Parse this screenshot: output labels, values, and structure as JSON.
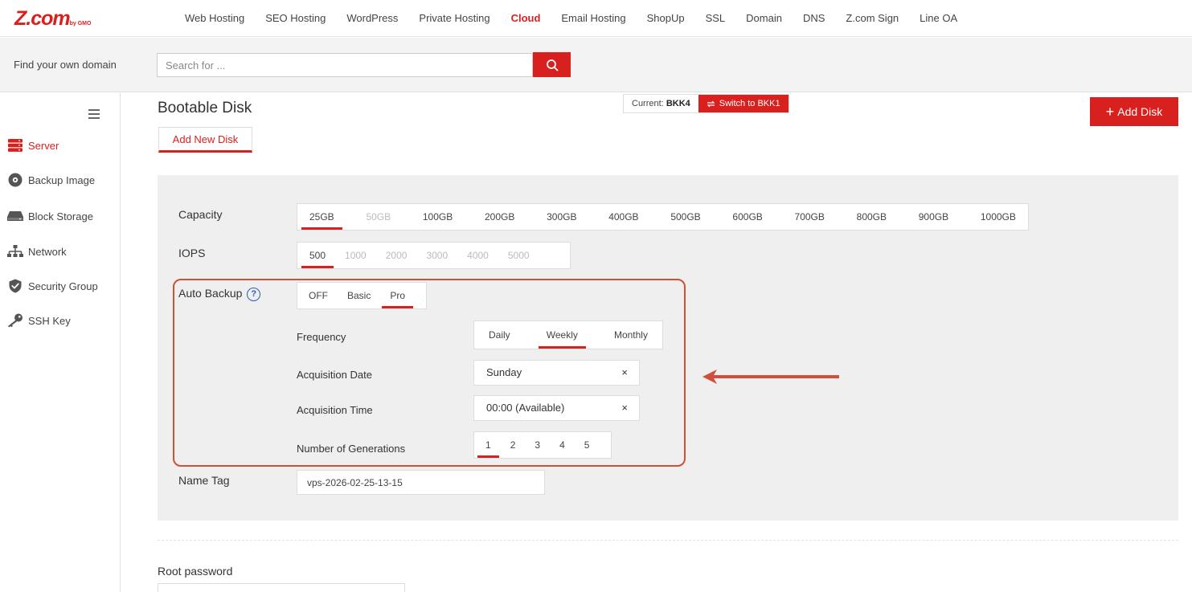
{
  "brand": {
    "logo_main": "Z.com",
    "logo_sub": "by GMO"
  },
  "nav": {
    "items": [
      {
        "label": "Web Hosting",
        "active": false
      },
      {
        "label": "SEO Hosting",
        "active": false
      },
      {
        "label": "WordPress",
        "active": false
      },
      {
        "label": "Private Hosting",
        "active": false
      },
      {
        "label": "Cloud",
        "active": true
      },
      {
        "label": "Email Hosting",
        "active": false
      },
      {
        "label": "ShopUp",
        "active": false
      },
      {
        "label": "SSL",
        "active": false
      },
      {
        "label": "Domain",
        "active": false
      },
      {
        "label": "DNS",
        "active": false
      },
      {
        "label": "Z.com Sign",
        "active": false
      },
      {
        "label": "Line OA",
        "active": false
      }
    ]
  },
  "search": {
    "label": "Find your own domain",
    "placeholder": "Search for ..."
  },
  "sidebar": {
    "items": [
      {
        "label": "Server",
        "icon": "server-icon",
        "active": true
      },
      {
        "label": "Backup Image",
        "icon": "disc-icon",
        "active": false
      },
      {
        "label": "Block Storage",
        "icon": "drive-icon",
        "active": false
      },
      {
        "label": "Network",
        "icon": "network-icon",
        "active": false
      },
      {
        "label": "Security Group",
        "icon": "shield-icon",
        "active": false
      },
      {
        "label": "SSH Key",
        "icon": "key-icon",
        "active": false
      }
    ]
  },
  "main": {
    "title": "Bootable Disk",
    "subtab": "Add New Disk",
    "region": {
      "current_label": "Current:",
      "current_value": "BKK4",
      "switch_label": "Switch to BKK1"
    },
    "add_disk_label": "Add Disk"
  },
  "form": {
    "capacity": {
      "label": "Capacity",
      "options": [
        {
          "label": "25GB",
          "selected": true,
          "disabled": false
        },
        {
          "label": "50GB",
          "selected": false,
          "disabled": true
        },
        {
          "label": "100GB",
          "selected": false,
          "disabled": false
        },
        {
          "label": "200GB",
          "selected": false,
          "disabled": false
        },
        {
          "label": "300GB",
          "selected": false,
          "disabled": false
        },
        {
          "label": "400GB",
          "selected": false,
          "disabled": false
        },
        {
          "label": "500GB",
          "selected": false,
          "disabled": false
        },
        {
          "label": "600GB",
          "selected": false,
          "disabled": false
        },
        {
          "label": "700GB",
          "selected": false,
          "disabled": false
        },
        {
          "label": "800GB",
          "selected": false,
          "disabled": false
        },
        {
          "label": "900GB",
          "selected": false,
          "disabled": false
        },
        {
          "label": "1000GB",
          "selected": false,
          "disabled": false
        }
      ]
    },
    "iops": {
      "label": "IOPS",
      "options": [
        {
          "label": "500",
          "selected": true,
          "disabled": false
        },
        {
          "label": "1000",
          "selected": false,
          "disabled": true
        },
        {
          "label": "2000",
          "selected": false,
          "disabled": true
        },
        {
          "label": "3000",
          "selected": false,
          "disabled": true
        },
        {
          "label": "4000",
          "selected": false,
          "disabled": true
        },
        {
          "label": "5000",
          "selected": false,
          "disabled": true
        }
      ]
    },
    "auto_backup": {
      "label": "Auto Backup",
      "help": "?",
      "options": [
        {
          "label": "OFF",
          "selected": false
        },
        {
          "label": "Basic",
          "selected": false
        },
        {
          "label": "Pro",
          "selected": true
        }
      ],
      "frequency": {
        "label": "Frequency",
        "options": [
          {
            "label": "Daily",
            "selected": false
          },
          {
            "label": "Weekly",
            "selected": true
          },
          {
            "label": "Monthly",
            "selected": false
          }
        ]
      },
      "acquisition_date": {
        "label": "Acquisition Date",
        "value": "Sunday",
        "clear": "×"
      },
      "acquisition_time": {
        "label": "Acquisition Time",
        "value": "00:00 (Available)",
        "clear": "×"
      },
      "generations": {
        "label": "Number of Generations",
        "options": [
          {
            "label": "1",
            "selected": true
          },
          {
            "label": "2",
            "selected": false
          },
          {
            "label": "3",
            "selected": false
          },
          {
            "label": "4",
            "selected": false
          },
          {
            "label": "5",
            "selected": false
          }
        ]
      }
    },
    "name_tag": {
      "label": "Name Tag",
      "value": "vps-2026-02-25-13-15"
    },
    "root_password": {
      "label": "Root password"
    }
  },
  "colors": {
    "accent": "#d8201f",
    "annotation": "#d14e3b",
    "panel_bg": "#efefef"
  }
}
